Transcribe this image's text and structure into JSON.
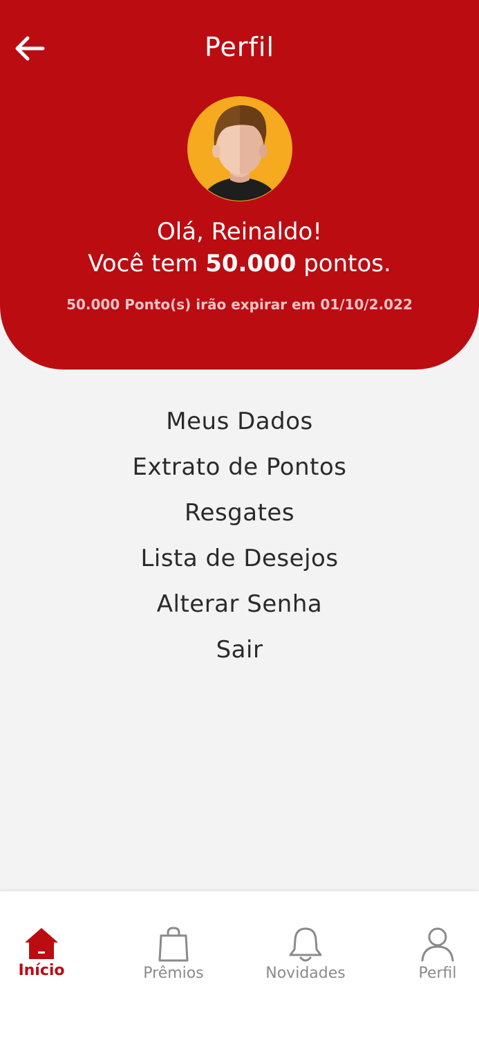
{
  "header": {
    "title": "Perfil",
    "greeting": "Olá, Reinaldo!",
    "points_prefix": "Você tem ",
    "points_value": "50.000",
    "points_suffix": " pontos.",
    "expire_note": "50.000 Ponto(s) irão expirar em 01/10/2.022"
  },
  "menu": {
    "items": [
      {
        "label": "Meus Dados"
      },
      {
        "label": "Extrato de Pontos"
      },
      {
        "label": "Resgates"
      },
      {
        "label": "Lista de Desejos"
      },
      {
        "label": "Alterar Senha"
      },
      {
        "label": "Sair"
      }
    ]
  },
  "tabbar": {
    "tabs": [
      {
        "label": "Início",
        "icon": "home-icon",
        "active": true
      },
      {
        "label": "Prêmios",
        "icon": "shopping-bag-icon",
        "active": false
      },
      {
        "label": "Novidades",
        "icon": "bell-icon",
        "active": false
      },
      {
        "label": "Perfil",
        "icon": "user-icon",
        "active": false
      }
    ]
  },
  "colors": {
    "brand_red": "#bb0c12",
    "background": "#f3f3f3",
    "tab_inactive": "#8a8a8a"
  }
}
